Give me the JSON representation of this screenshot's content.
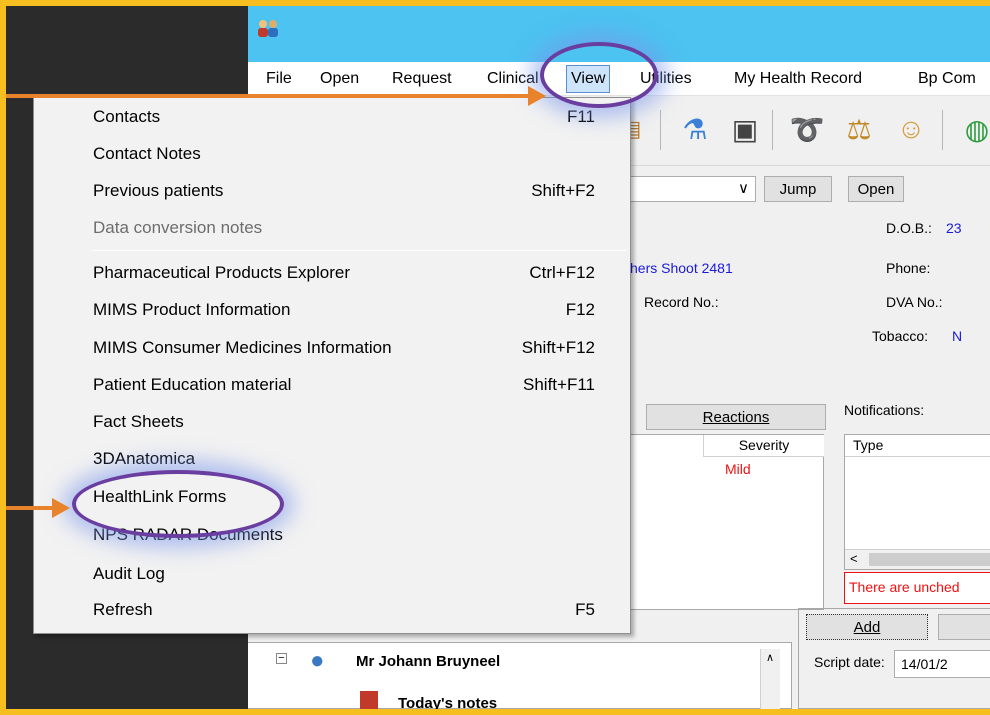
{
  "menubar": {
    "items": [
      "File",
      "Open",
      "Request",
      "Clinical",
      "View",
      "Utilities",
      "My Health Record",
      "Bp Com"
    ],
    "active": "View"
  },
  "toolbar": {
    "icons": [
      "document-icon",
      "flask-icon",
      "xray-icon",
      "stethoscope-icon",
      "scales-icon",
      "person-icon",
      "globe-icon"
    ]
  },
  "patient_bar": {
    "jump_label": "Jump",
    "open_label": "Open"
  },
  "patient_info": {
    "dob_label": "D.O.B.:",
    "dob_value": "23",
    "address_value": "hers Shoot  2481",
    "phone_label": "Phone:",
    "record_label": "Record No.:",
    "dva_label": "DVA No.:",
    "tobacco_label": "Tobacco:",
    "tobacco_value": "N"
  },
  "reactions": {
    "button_label": "Reactions",
    "col_severity": "Severity",
    "row_severity": "Mild"
  },
  "notifications": {
    "label": "Notifications:",
    "col_type": "Type",
    "warning": "There are unched"
  },
  "script": {
    "add_label": "Add",
    "date_label": "Script date:",
    "date_value": "14/01/2"
  },
  "tree": {
    "patient_name": "Mr Johann Bruyneel",
    "child": "Today's notes"
  },
  "view_menu": {
    "items": [
      {
        "label": "Contacts",
        "shortcut": "F11"
      },
      {
        "label": "Contact Notes",
        "shortcut": ""
      },
      {
        "label": "Previous patients",
        "shortcut": "Shift+F2"
      },
      {
        "label": "Data conversion notes",
        "shortcut": ""
      },
      {
        "label": "Pharmaceutical Products Explorer",
        "shortcut": "Ctrl+F12"
      },
      {
        "label": "MIMS Product Information",
        "shortcut": "F12"
      },
      {
        "label": "MIMS Consumer Medicines Information",
        "shortcut": "Shift+F12"
      },
      {
        "label": "Patient Education material",
        "shortcut": "Shift+F11"
      },
      {
        "label": "Fact Sheets",
        "shortcut": ""
      },
      {
        "label": "3DAnatomica",
        "shortcut": ""
      },
      {
        "label": "HealthLink Forms",
        "shortcut": ""
      },
      {
        "label": "NPS RADAR Documents",
        "shortcut": ""
      },
      {
        "label": "Audit Log",
        "shortcut": ""
      },
      {
        "label": "Refresh",
        "shortcut": "F5"
      }
    ]
  },
  "colors": {
    "frame": "#f6be1e",
    "arrow": "#e8822b",
    "ring": "#6a3ea0",
    "titlebar": "#4cc3f0"
  }
}
